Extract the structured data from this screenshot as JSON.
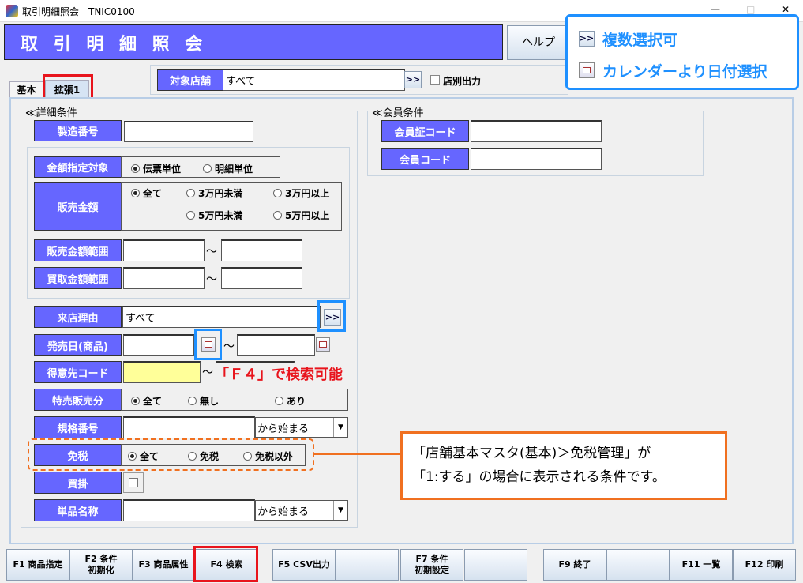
{
  "window": {
    "title": "取引明細照会　TNIC0100",
    "controls": [
      "—",
      "□",
      "✕"
    ]
  },
  "header": {
    "title": "取 引 明 細 照 会",
    "help": "ヘルプ"
  },
  "legend": {
    "multi_icon": ">>",
    "multi_label": "複数選択可",
    "calendar_label": "カレンダーより日付選択"
  },
  "store": {
    "label": "対象店舗",
    "value": "すべて",
    "button": ">>",
    "checkbox_label": "店別出力"
  },
  "tabs": [
    {
      "label": "基本"
    },
    {
      "label": "拡張1"
    }
  ],
  "detail": {
    "title": "≪詳細条件",
    "serial": {
      "label": "製造番号",
      "value": ""
    },
    "amount_target": {
      "label": "金額指定対象",
      "options": [
        "伝票単位",
        "明細単位"
      ],
      "selected": 0
    },
    "sales_amount": {
      "label": "販売金額",
      "options": [
        "全て",
        "3万円未満",
        "3万円以上",
        "5万円未満",
        "5万円以上"
      ],
      "selected": 0
    },
    "sales_range": {
      "label": "販売金額範囲",
      "tilde": "～"
    },
    "buy_range": {
      "label": "買取金額範囲",
      "tilde": "～"
    },
    "visit_reason": {
      "label": "来店理由",
      "value": "すべて",
      "button": ">>"
    },
    "release_date": {
      "label": "発売日(商品)",
      "tilde": "～"
    },
    "customer": {
      "label": "得意先コード",
      "tilde": "～",
      "note": "「Ｆ４」で検索可能"
    },
    "special": {
      "label": "特売販売分",
      "options": [
        "全て",
        "無し",
        "あり"
      ],
      "selected": 0
    },
    "spec_no": {
      "label": "規格番号",
      "match": "から始まる"
    },
    "tax_free": {
      "label": "免税",
      "options": [
        "全て",
        "免税",
        "免税以外"
      ],
      "selected": 0
    },
    "credit": {
      "label": "買掛"
    },
    "item_name": {
      "label": "単品名称",
      "match": "から始まる"
    }
  },
  "member": {
    "title": "≪会員条件",
    "card": {
      "label": "会員証コード"
    },
    "code": {
      "label": "会員コード"
    }
  },
  "callout": {
    "line1": "「店舗基本マスタ(基本)＞免税管理」が",
    "line2": "「1:する」の場合に表示される条件です。"
  },
  "fkeys": [
    {
      "label": "F1 商品指定"
    },
    {
      "label": "F2 条件\n初期化"
    },
    {
      "label": "F3 商品属性"
    },
    {
      "label": "F4 検索"
    },
    {
      "label": "F5 CSV出力"
    },
    {
      "label": ""
    },
    {
      "label": "F7 条件\n初期設定"
    },
    {
      "label": ""
    },
    {
      "label": "F9 終了"
    },
    {
      "label": ""
    },
    {
      "label": "F11 一覧"
    },
    {
      "label": "F12 印刷"
    }
  ],
  "colors": {
    "label_bg": "#6666ff",
    "highlight_blue": "#1e90ff",
    "highlight_red": "#e8141c",
    "callout_orange": "#f07020"
  }
}
